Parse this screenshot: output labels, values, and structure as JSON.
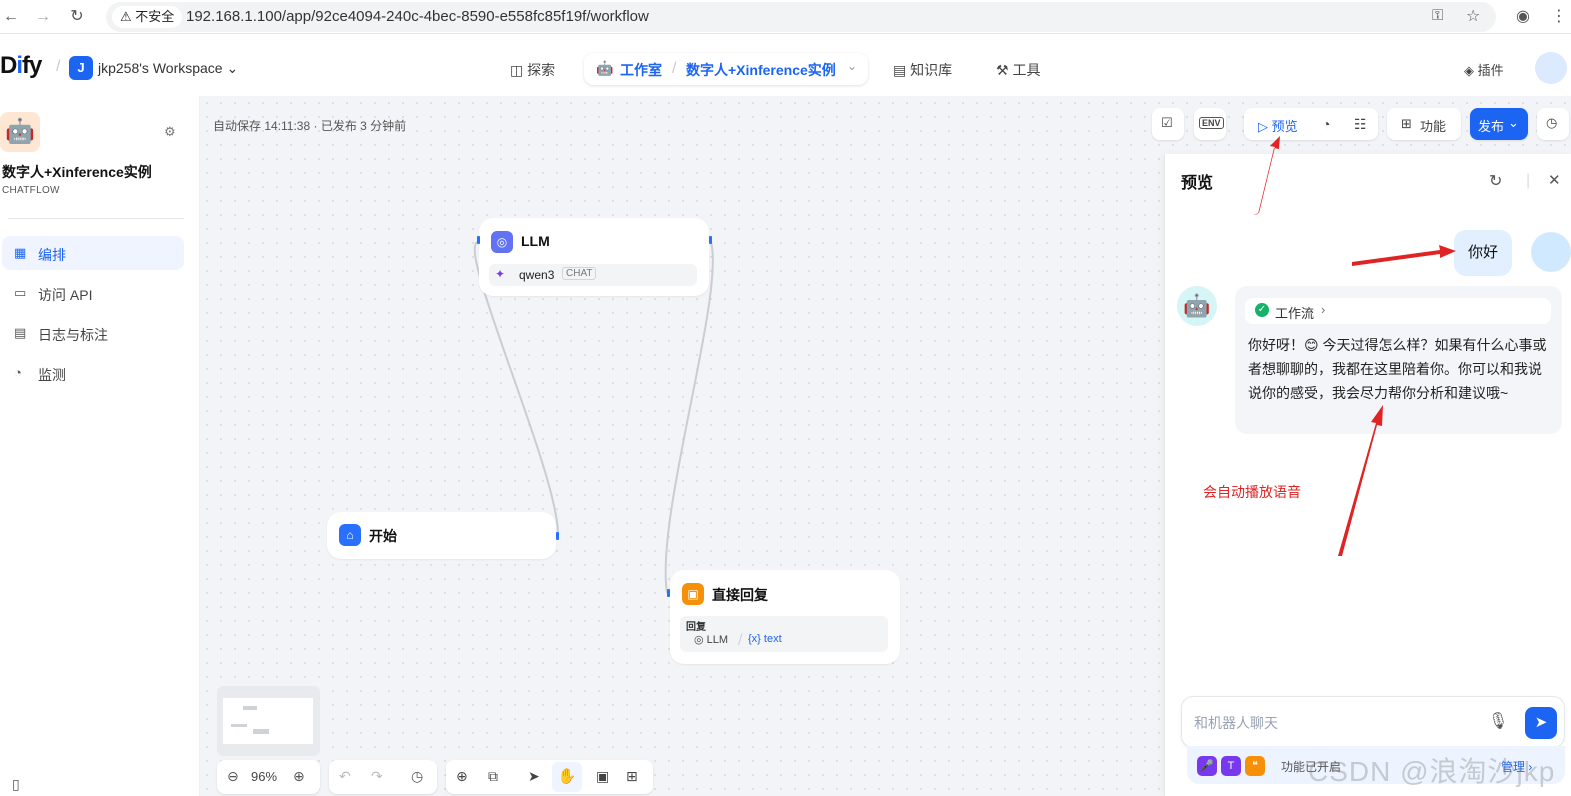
{
  "browser": {
    "security_label": "不安全",
    "url": "192.168.1.100/app/92ce4094-240c-4bec-8590-e558fc85f19f/workflow"
  },
  "header": {
    "logo": "Dify",
    "workspace_initial": "J",
    "workspace_name": "jkp258's Workspace",
    "nav": {
      "explore": "探索",
      "studio": "工作室",
      "current_app": "数字人+Xinference实例",
      "knowledge": "知识库",
      "tools": "工具",
      "plugins": "插件"
    }
  },
  "sidebar": {
    "app_name": "数字人+Xinference实例",
    "app_type": "CHATFLOW",
    "items": [
      {
        "label": "编排",
        "icon": "layout-icon",
        "active": true
      },
      {
        "label": "访问 API",
        "icon": "terminal-icon",
        "active": false
      },
      {
        "label": "日志与标注",
        "icon": "file-list-icon",
        "active": false
      },
      {
        "label": "监测",
        "icon": "gauge-icon",
        "active": false
      }
    ]
  },
  "canvas": {
    "autosave": "自动保存 14:11:38 · 已发布 3 分钟前",
    "zoom": "96%",
    "nodes": {
      "llm": {
        "title": "LLM",
        "model": "qwen3",
        "model_tag": "CHAT"
      },
      "start": {
        "title": "开始"
      },
      "answer": {
        "title": "直接回复",
        "field_label": "回复",
        "var_source": "LLM",
        "var_name": "{x} text"
      }
    }
  },
  "toolbar": {
    "env": "ENV",
    "preview": "预览",
    "features": "功能",
    "publish": "发布"
  },
  "preview": {
    "title": "预览",
    "user_message": "你好",
    "workflow_chip": "工作流",
    "bot_reply": "你好呀！😊 今天过得怎么样？如果有什么心事或者想聊聊的，我都在这里陪着你。你可以和我说说你的感受，我会尽力帮你分析和建议哦~",
    "annotation": "会自动播放语音",
    "input_placeholder": "和机器人聊天",
    "features_enabled": "功能已开启",
    "manage": "管理"
  },
  "watermark": "CSDN @浪淘沙jkp",
  "colors": {
    "accent": "#1c64f2",
    "annotation_red": "#e02424"
  }
}
